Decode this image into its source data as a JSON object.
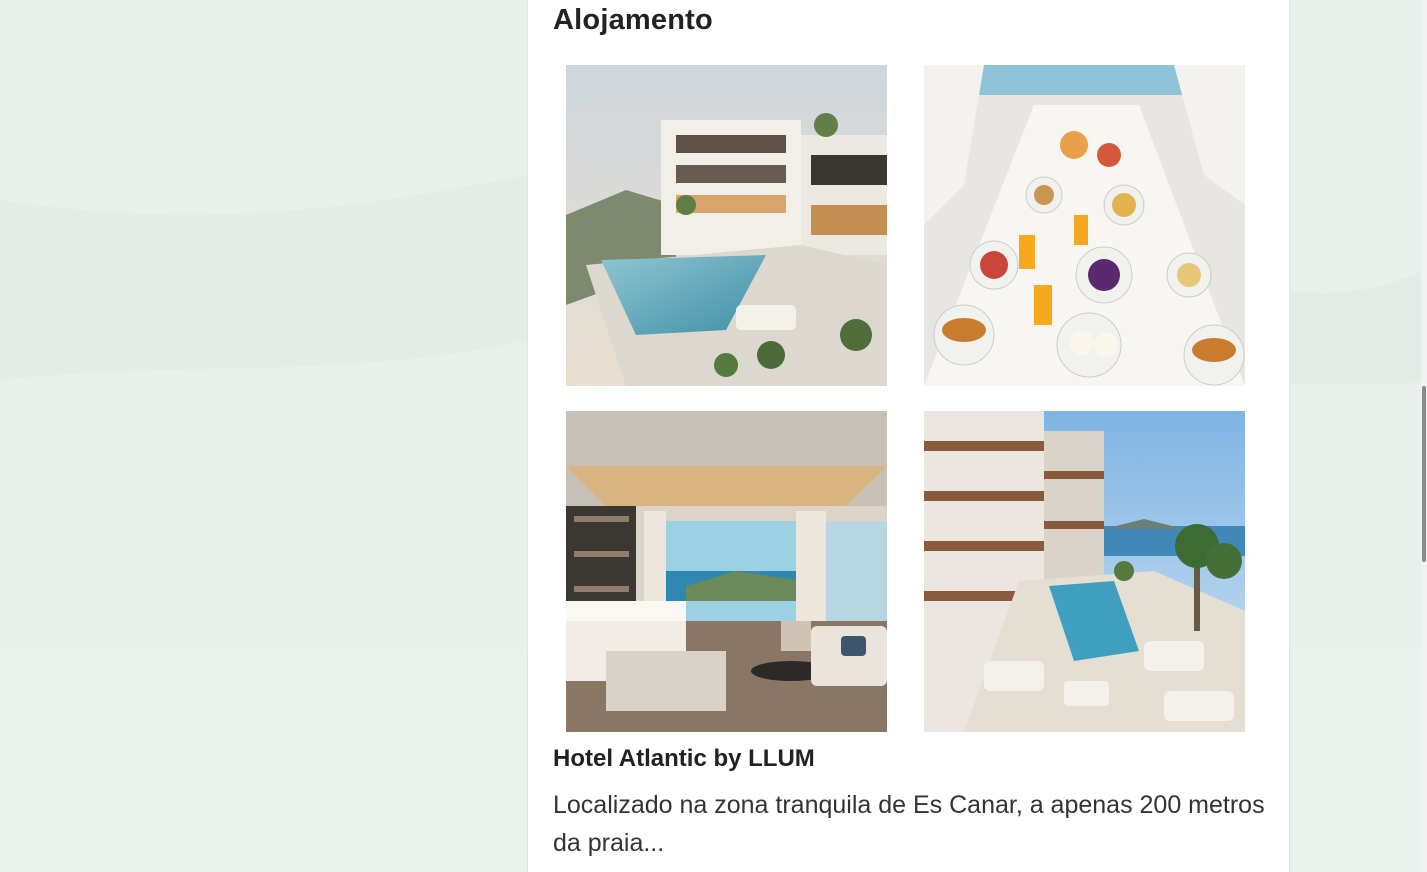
{
  "section": {
    "title": "Alojamento"
  },
  "gallery": {
    "images": [
      {
        "icon": "hotel-exterior-pool-photo"
      },
      {
        "icon": "breakfast-buffet-photo"
      },
      {
        "icon": "hotel-room-interior-photo"
      },
      {
        "icon": "hotel-pool-terrace-photo"
      }
    ]
  },
  "hotel": {
    "name": "Hotel Atlantic by LLUM",
    "description": "Localizado na zona tranquila de Es Canar, a apenas 200 metros da praia..."
  },
  "colors": {
    "background": "#e6efe8",
    "card": "#ffffff",
    "text": "#222222"
  }
}
